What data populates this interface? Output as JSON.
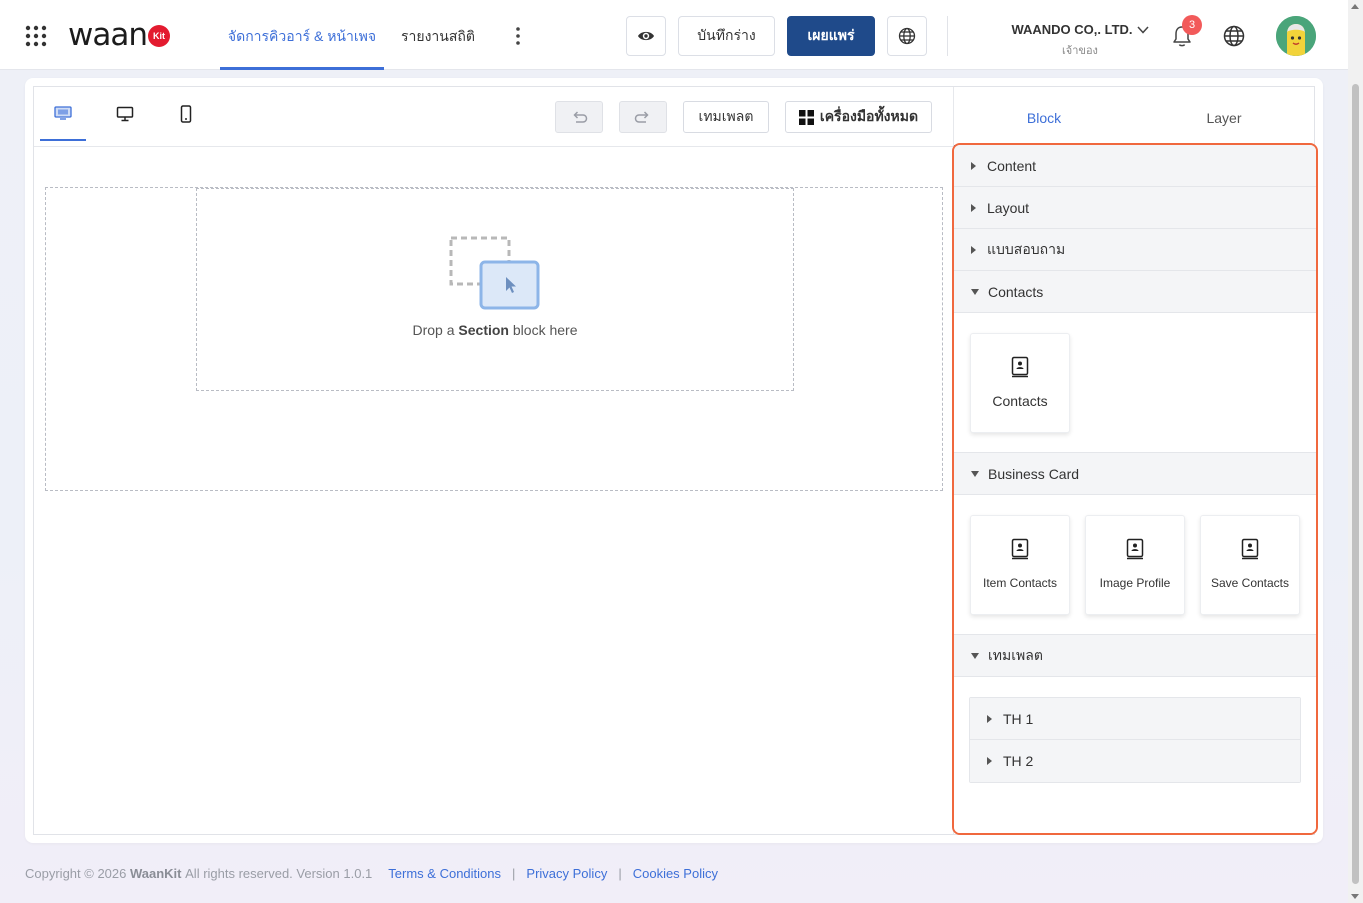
{
  "brand": {
    "logo_text": "waan",
    "logo_badge": "Kit"
  },
  "nav": {
    "tabs": [
      {
        "label": "จัดการคิวอาร์ & หน้าเพจ",
        "active": true
      },
      {
        "label": "รายงานสถิติ",
        "active": false
      }
    ]
  },
  "header": {
    "save_draft": "บันทึกร่าง",
    "publish": "เผยแพร่",
    "org_name": "WAANDO CO,. LTD.",
    "org_role": "เจ้าของ",
    "notification_count": "3"
  },
  "toolbar": {
    "template": "เทมเพลต",
    "all_tools": "เครื่องมือทั้งหมด"
  },
  "canvas": {
    "drop_prefix": "Drop a",
    "drop_bold": "Section",
    "drop_suffix": "block here"
  },
  "panel": {
    "tabs": {
      "block": "Block",
      "layer": "Layer"
    },
    "categories": {
      "content": "Content",
      "layout": "Layout",
      "survey": "แบบสอบถาม",
      "contacts": "Contacts",
      "business_card": "Business Card",
      "template": "เทมเพลต"
    },
    "contacts_blocks": [
      "Contacts"
    ],
    "business_card_blocks": [
      "Item Contacts",
      "Image Profile",
      "Save Contacts"
    ],
    "templates": [
      "TH 1",
      "TH 2"
    ]
  },
  "footer": {
    "copyright_prefix": "Copyright © 2026",
    "company": "WaanKit",
    "copyright_suffix": "All rights reserved. Version 1.0.1",
    "links": [
      "Terms & Conditions",
      "Privacy Policy",
      "Cookies Policy"
    ],
    "separator": "|"
  },
  "colors": {
    "accent": "#3d6fd8",
    "publish": "#1f4a8a",
    "highlight": "#f0683e",
    "badge": "#f25a5a",
    "logo_badge": "#e31b2f"
  }
}
